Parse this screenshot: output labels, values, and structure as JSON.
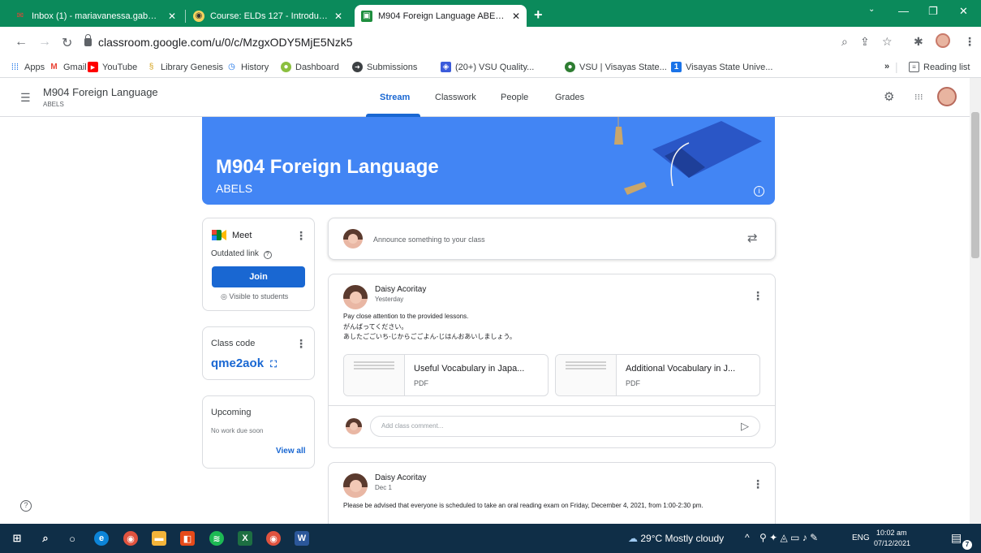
{
  "browser": {
    "tabs": [
      {
        "title": "Inbox (1) - mariavanessa.gabuna",
        "close": "✕"
      },
      {
        "title": "Course: ELDs 127 - Introduction t",
        "close": "✕"
      },
      {
        "title": "M904 Foreign Language ABELS",
        "close": "✕"
      }
    ],
    "new_tab": "+",
    "url": "classroom.google.com/u/0/c/MzgxODY5MjE5Nzk5",
    "bookmarks": [
      {
        "label": "Apps"
      },
      {
        "label": "Gmail"
      },
      {
        "label": "YouTube"
      },
      {
        "label": "Library Genesis"
      },
      {
        "label": "History"
      },
      {
        "label": "Dashboard"
      },
      {
        "label": "Submissions"
      },
      {
        "label": "(20+) VSU Quality..."
      },
      {
        "label": "VSU | Visayas State..."
      },
      {
        "label": "Visayas State Unive..."
      }
    ],
    "more_bookmarks": "»",
    "reading_list": "Reading list"
  },
  "classroom": {
    "header_title": "M904 Foreign Language",
    "header_sub": "ABELS",
    "nav": [
      "Stream",
      "Classwork",
      "People",
      "Grades"
    ],
    "banner_title": "M904 Foreign Language",
    "banner_sub": "ABELS",
    "meet": {
      "title": "Meet",
      "outdated": "Outdated link",
      "join": "Join",
      "visible": "Visible to students"
    },
    "class_code": {
      "label": "Class code",
      "value": "qme2aok"
    },
    "upcoming": {
      "label": "Upcoming",
      "none": "No work due soon",
      "view_all": "View all"
    },
    "announce_placeholder": "Announce something to your class",
    "posts": [
      {
        "author": "Daisy Acoritay",
        "date": "Yesterday",
        "lines": [
          "Pay close attention to the provided lessons.",
          "がんばってください。",
          "あしたごごいち-じからごごよん-じはんおあいしましょう。"
        ],
        "attachments": [
          {
            "name": "Useful Vocabulary in Japa...",
            "type": "PDF"
          },
          {
            "name": "Additional Vocabulary in J...",
            "type": "PDF"
          }
        ],
        "comment_placeholder": "Add class comment..."
      },
      {
        "author": "Daisy Acoritay",
        "date": "Dec 1",
        "lines": [
          "Please be advised that everyone is scheduled to take an oral reading exam on Friday, December 4, 2021, from 1:00-2:30 pm."
        ]
      }
    ]
  },
  "taskbar": {
    "weather": "29°C  Mostly cloudy",
    "lang": "ENG",
    "time": "10:02 am",
    "date": "07/12/2021",
    "notif_count": "7"
  },
  "colors": {
    "tab_strip": "#0b8a5b",
    "banner": "#4285f4",
    "accent": "#1967d2",
    "taskbar": "#0f2e47"
  }
}
